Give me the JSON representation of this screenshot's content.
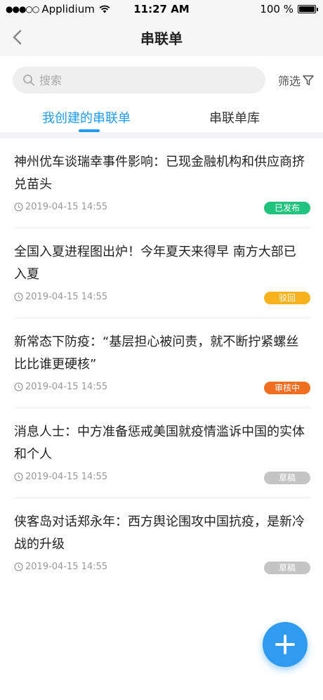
{
  "status_bar": {
    "carrier": "Applidium",
    "time": "11:27 AM",
    "battery": "100 %",
    "battery_level": 1.0
  },
  "nav": {
    "title": "串联单",
    "back_icon": "chevron-left-icon"
  },
  "search": {
    "placeholder": "搜索",
    "filter_label": "筛选"
  },
  "tabs": [
    {
      "label": "我创建的串联单",
      "active": true
    },
    {
      "label": "串联单库",
      "active": false
    }
  ],
  "items": [
    {
      "title": "神州优车谈瑞幸事件影响：已现金融机构和供应商挤兑苗头",
      "date": "2019-04-15  14:55",
      "status": "已发布"
    },
    {
      "title": "全国入夏进程图出炉！今年夏天来得早 南方大部已入夏",
      "date": "2019-04-15  14:55",
      "status": "驳回"
    },
    {
      "title": "新常态下防疫：“基层担心被问责，就不断拧紧螺丝比比谁更硬核”",
      "date": "2019-04-15  14:55",
      "status": "审核中"
    },
    {
      "title": "消息人士：中方准备惩戒美国就疫情滥诉中国的实体和个人",
      "date": "2019-04-15  14:55",
      "status": "草稿"
    },
    {
      "title": "侠客岛对话郑永年：西方舆论围攻中国抗疫，是新冷战的升级",
      "date": "2019-04-15  14:55",
      "status": "草稿"
    }
  ],
  "colors": {
    "accent": "#1f9bef",
    "published": "#21c37e",
    "rejected": "#f7b21e",
    "reviewing": "#f06e21",
    "draft": "#c4c4c4"
  },
  "fab": {
    "icon": "plus-icon"
  }
}
